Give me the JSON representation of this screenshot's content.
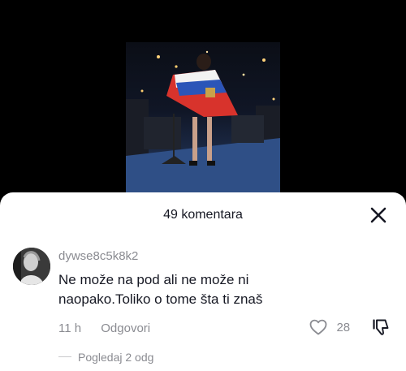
{
  "sheet": {
    "title": "49 komentara",
    "close_icon": "close-icon"
  },
  "comment": {
    "username": "dywse8c5k8k2",
    "text": "Ne može na pod ali ne može ni naopako.Toliko o tome šta ti znaš",
    "time": "11 h",
    "reply_label": "Odgovori",
    "like_count": "28",
    "like_icon": "heart-icon",
    "dislike_icon": "thumbs-down-icon"
  },
  "replies": {
    "label": "Pogledaj 2 odg"
  },
  "colors": {
    "text_primary": "#161823",
    "text_secondary": "#8a8b91",
    "sheet_bg": "#ffffff",
    "page_bg": "#000000"
  }
}
